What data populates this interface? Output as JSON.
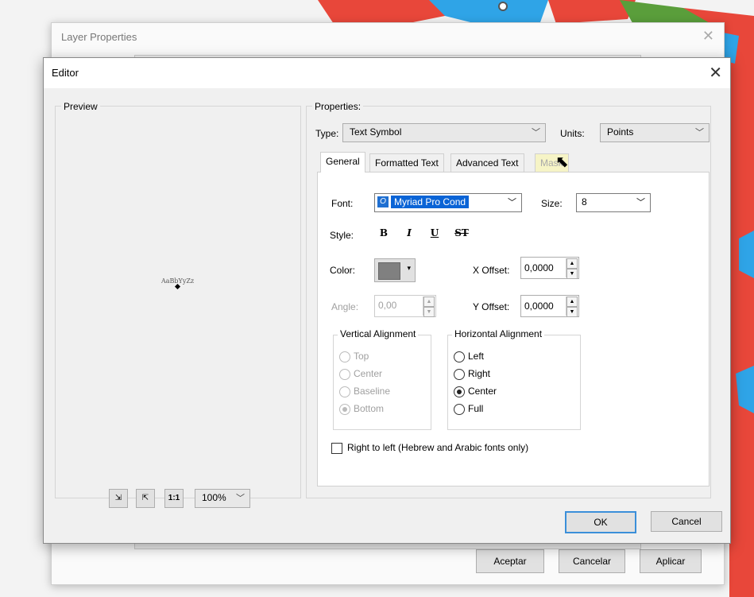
{
  "layer_properties": {
    "title": "Layer Properties",
    "buttons": {
      "accept": "Aceptar",
      "cancel": "Cancelar",
      "apply": "Aplicar"
    }
  },
  "editor": {
    "title": "Editor",
    "preview": {
      "label": "Preview",
      "sample_text": "AaBbYyZz",
      "zoom": "100%"
    },
    "properties": {
      "label": "Properties:",
      "type_label": "Type:",
      "type_value": "Text Symbol",
      "units_label": "Units:",
      "units_value": "Points",
      "tabs": [
        "General",
        "Formatted Text",
        "Advanced Text",
        "Mask"
      ],
      "general": {
        "font_label": "Font:",
        "font_value": "Myriad Pro Cond",
        "size_label": "Size:",
        "size_value": "8",
        "style_label": "Style:",
        "style_buttons": [
          "B",
          "I",
          "U",
          "ST"
        ],
        "color_label": "Color:",
        "color_value": "#808080",
        "x_offset_label": "X Offset:",
        "x_offset_value": "0,0000",
        "angle_label": "Angle:",
        "angle_value": "0,00",
        "y_offset_label": "Y Offset:",
        "y_offset_value": "0,0000",
        "vertical_alignment": {
          "label": "Vertical Alignment",
          "options": [
            "Top",
            "Center",
            "Baseline",
            "Bottom"
          ],
          "selected": "Bottom"
        },
        "horizontal_alignment": {
          "label": "Horizontal Alignment",
          "options": [
            "Left",
            "Right",
            "Center",
            "Full"
          ],
          "selected": "Center"
        },
        "rtl_label": "Right to left (Hebrew and Arabic fonts only)"
      }
    },
    "buttons": {
      "ok": "OK",
      "cancel": "Cancel"
    }
  }
}
